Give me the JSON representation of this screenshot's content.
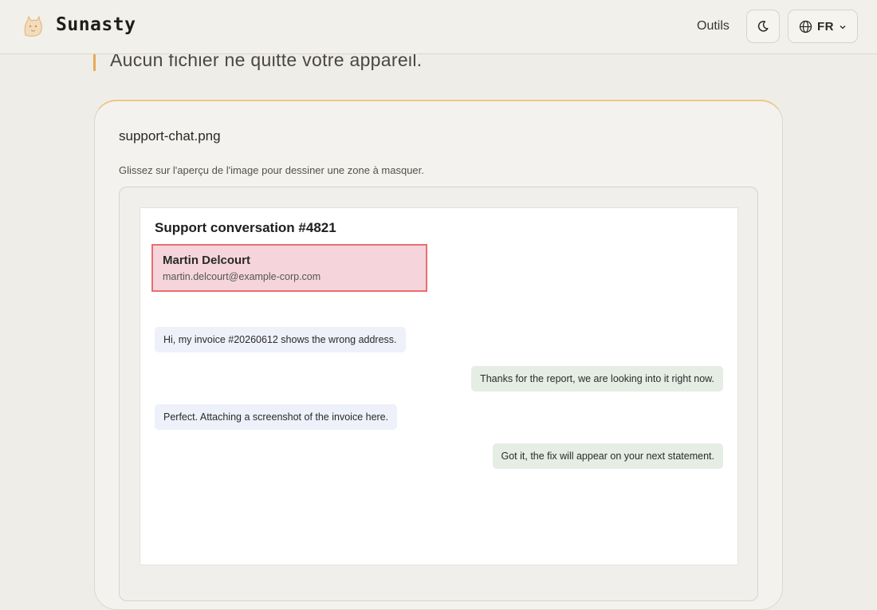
{
  "header": {
    "brand": "Sunasty",
    "tools_label": "Outils",
    "language": "FR",
    "icons": [
      "cat-logo-icon",
      "moon-icon",
      "globe-icon",
      "chevron-down-icon"
    ]
  },
  "intro": {
    "text": "Aucun fichier ne quitte votre appareil."
  },
  "editor": {
    "file_name": "support-chat.png",
    "hint": "Glissez sur l'aperçu de l'image pour dessiner une zone à masquer."
  },
  "preview": {
    "title": "Support conversation #4821",
    "masked_name": "Martin Delcourt",
    "masked_email": "martin.delcourt@example-corp.com",
    "messages": [
      {
        "side": "left",
        "text": "Hi, my invoice #20260612 shows the wrong address."
      },
      {
        "side": "right",
        "text": "Thanks for the report, we are looking into it right now."
      },
      {
        "side": "left",
        "text": "Perfect. Attaching a screenshot of the invoice here."
      },
      {
        "side": "right",
        "text": "Got it, the fix will appear on your next statement."
      }
    ]
  },
  "colors": {
    "accent": "#e8a95a",
    "mask_fill": "#f5d5db",
    "mask_border": "#ea6d70"
  }
}
